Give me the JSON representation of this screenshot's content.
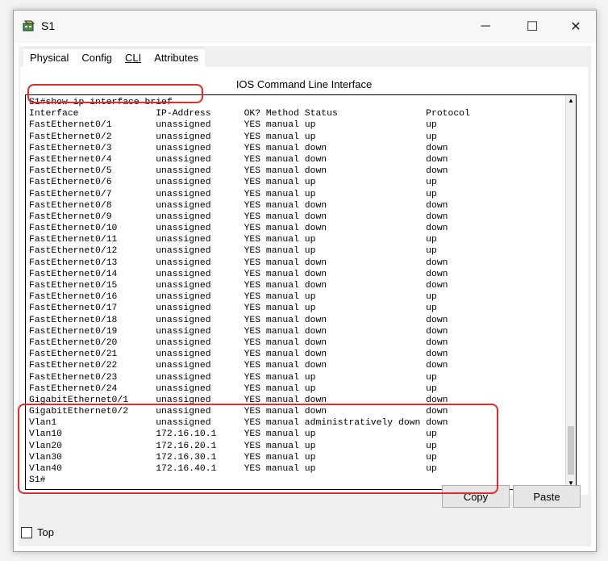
{
  "window": {
    "title": "S1",
    "minimize_glyph": "─",
    "maximize_glyph": "☐",
    "close_glyph": "✕",
    "icon": "switch-device-icon"
  },
  "tabs": [
    {
      "label": "Physical"
    },
    {
      "label": "Config"
    },
    {
      "label": "CLI",
      "active": true
    },
    {
      "label": "Attributes"
    }
  ],
  "panel": {
    "title": "IOS Command Line Interface"
  },
  "terminal": {
    "lines": [
      "S1#show ip interface brief",
      "Interface              IP-Address      OK? Method Status                Protocol",
      "FastEthernet0/1        unassigned      YES manual up                    up",
      "FastEthernet0/2        unassigned      YES manual up                    up",
      "FastEthernet0/3        unassigned      YES manual down                  down",
      "FastEthernet0/4        unassigned      YES manual down                  down",
      "FastEthernet0/5        unassigned      YES manual down                  down",
      "FastEthernet0/6        unassigned      YES manual up                    up",
      "FastEthernet0/7        unassigned      YES manual up                    up",
      "FastEthernet0/8        unassigned      YES manual down                  down",
      "FastEthernet0/9        unassigned      YES manual down                  down",
      "FastEthernet0/10       unassigned      YES manual down                  down",
      "FastEthernet0/11       unassigned      YES manual up                    up",
      "FastEthernet0/12       unassigned      YES manual up                    up",
      "FastEthernet0/13       unassigned      YES manual down                  down",
      "FastEthernet0/14       unassigned      YES manual down                  down",
      "FastEthernet0/15       unassigned      YES manual down                  down",
      "FastEthernet0/16       unassigned      YES manual up                    up",
      "FastEthernet0/17       unassigned      YES manual up                    up",
      "FastEthernet0/18       unassigned      YES manual down                  down",
      "FastEthernet0/19       unassigned      YES manual down                  down",
      "FastEthernet0/20       unassigned      YES manual down                  down",
      "FastEthernet0/21       unassigned      YES manual down                  down",
      "FastEthernet0/22       unassigned      YES manual down                  down",
      "FastEthernet0/23       unassigned      YES manual up                    up",
      "FastEthernet0/24       unassigned      YES manual up                    up",
      "GigabitEthernet0/1     unassigned      YES manual down                  down",
      "GigabitEthernet0/2     unassigned      YES manual down                  down",
      "Vlan1                  unassigned      YES manual administratively down down",
      "Vlan10                 172.16.10.1     YES manual up                    up",
      "Vlan20                 172.16.20.1     YES manual up                    up",
      "Vlan30                 172.16.30.1     YES manual up                    up",
      "Vlan40                 172.16.40.1     YES manual up                    up",
      "S1#"
    ]
  },
  "buttons": {
    "copy": "Copy",
    "paste": "Paste"
  },
  "top_checkbox": {
    "label": "Top",
    "checked": false
  },
  "colors": {
    "highlight": "#e32b2b"
  }
}
